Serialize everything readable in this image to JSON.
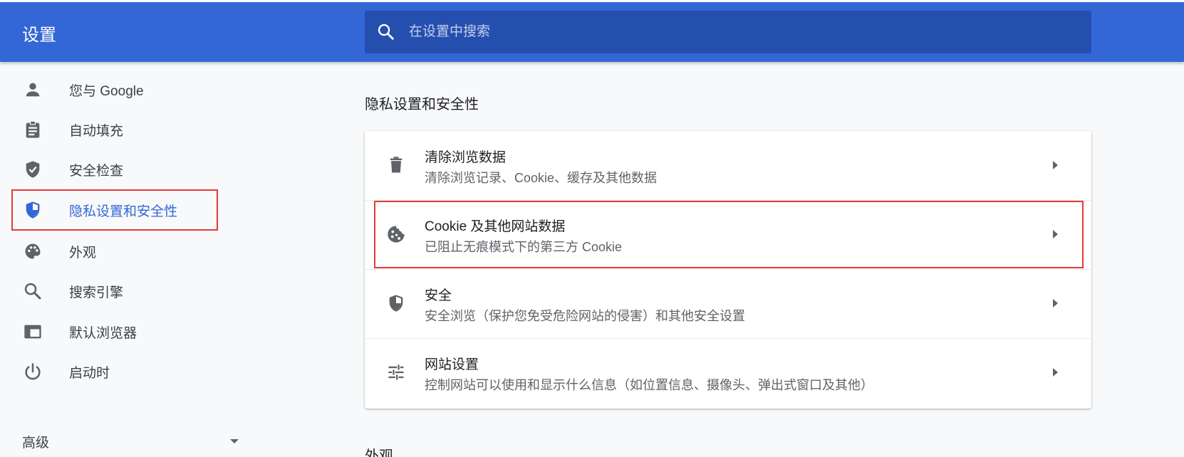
{
  "header": {
    "title": "设置",
    "search_placeholder": "在设置中搜索",
    "search_value": ""
  },
  "sidebar": {
    "items": [
      {
        "label": "您与 Google",
        "icon": "person-icon"
      },
      {
        "label": "自动填充",
        "icon": "clipboard-icon"
      },
      {
        "label": "安全检查",
        "icon": "shield-check-icon"
      },
      {
        "label": "隐私设置和安全性",
        "icon": "privacy-shield-icon",
        "active": true
      },
      {
        "label": "外观",
        "icon": "palette-icon"
      },
      {
        "label": "搜索引擎",
        "icon": "search-icon"
      },
      {
        "label": "默认浏览器",
        "icon": "browser-window-icon"
      },
      {
        "label": "启动时",
        "icon": "power-icon"
      }
    ],
    "advanced_label": "高级"
  },
  "main": {
    "section_title": "隐私设置和安全性",
    "rows": [
      {
        "title": "清除浏览数据",
        "subtitle": "清除浏览记录、Cookie、缓存及其他数据",
        "icon": "trash-icon"
      },
      {
        "title": "Cookie 及其他网站数据",
        "subtitle": "已阻止无痕模式下的第三方 Cookie",
        "icon": "cookie-icon",
        "highlighted": true
      },
      {
        "title": "安全",
        "subtitle": "安全浏览（保护您免受危险网站的侵害）和其他安全设置",
        "icon": "security-shield-icon"
      },
      {
        "title": "网站设置",
        "subtitle": "控制网站可以使用和显示什么信息（如位置信息、摄像头、弹出式窗口及其他）",
        "icon": "tune-icon"
      }
    ],
    "next_section_title": "外观"
  },
  "colors": {
    "header_bg": "#3367d6",
    "search_bg": "#254fae",
    "active_text": "#3367d6",
    "highlight_border": "#e53935",
    "page_bg": "#f8f9fa"
  }
}
